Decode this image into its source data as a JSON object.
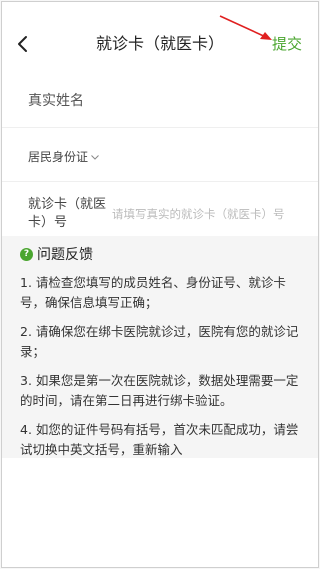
{
  "nav": {
    "title": "就诊卡（就医卡）",
    "submit_label": "提交",
    "accent_color": "#4aa52f",
    "annotation_color": "#e02020"
  },
  "form": {
    "name_placeholder": "真实姓名",
    "id_type_selected": "居民身份证",
    "card_label": "就诊卡（就医卡）号",
    "card_placeholder": "请填写真实的就诊卡（就医卡）号"
  },
  "faq": {
    "title": "问题反馈",
    "items": [
      "1. 请检查您填写的成员姓名、身份证号、就诊卡号，确保信息填写正确；",
      "2. 请确保您在绑卡医院就诊过，医院有您的就诊记录；",
      "3. 如果您是第一次在医院就诊，数据处理需要一定的时间，请在第二日再进行绑卡验证。",
      "4. 如您的证件号码有括号，首次未匹配成功，请尝试切换中英文括号，重新输入"
    ]
  },
  "icons": [
    "back-arrow-icon",
    "chevron-down-icon",
    "question-icon",
    "annotation-arrow-icon"
  ]
}
